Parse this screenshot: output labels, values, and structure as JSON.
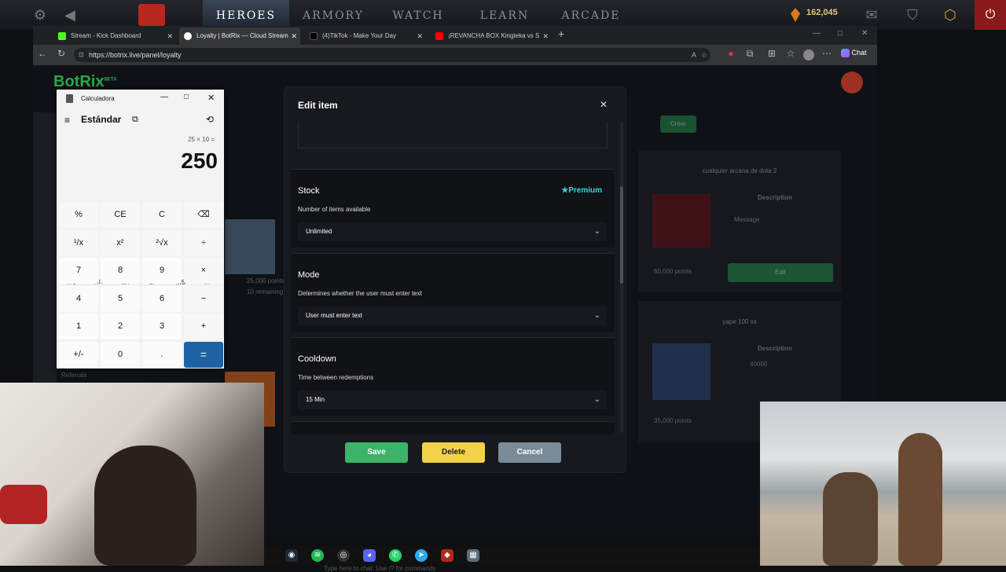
{
  "dota": {
    "tabs": [
      {
        "label": "HEROES",
        "active": true
      },
      {
        "label": "ARMORY",
        "active": false
      },
      {
        "label": "WATCH",
        "active": false
      },
      {
        "label": "LEARN",
        "active": false
      },
      {
        "label": "ARCADE",
        "active": false
      }
    ],
    "shards": "162,045"
  },
  "browser": {
    "tabs": [
      {
        "title": "Stream - Kick Dashboard",
        "color": "#53fc18"
      },
      {
        "title": "Loyalty | BotRix — Cloud Streaming",
        "color": "#ffffff"
      },
      {
        "title": "(4)TikTok - Make Your Day",
        "color": "#000000"
      },
      {
        "title": "¡REVANCHA BOX Kingteka vs S",
        "color": "#ff0000"
      }
    ],
    "url": "https://botrix.live/panel/loyalty",
    "chat_label": "Chat"
  },
  "background_page": {
    "logo": "BotRix",
    "logo_sup": "BETA",
    "create_label": "Crear",
    "sidebar_label": "Referrals",
    "card1": {
      "title": "cualquier arcana de dota 2",
      "desc_header": "Description",
      "desc": "Message",
      "points": "60,000 points",
      "button": "Edit"
    },
    "card2": {
      "title": "yape 100 ss",
      "desc_header": "Description",
      "desc": "40000",
      "points": "35,000 points"
    },
    "left_item": {
      "points": "25,000 points",
      "remaining": "10 remaining"
    },
    "chat_placeholder": "Type here to chat. Use /? for commands"
  },
  "calculator": {
    "title": "Calculadora",
    "mode": "Estándar",
    "expression": "25 × 10 =",
    "display": "250",
    "memory": [
      "MC",
      "MR",
      "M+",
      "M−",
      "MS",
      "M˅"
    ],
    "keys": [
      [
        "%",
        "CE",
        "C",
        "⌫"
      ],
      [
        "¹/x",
        "x²",
        "²√x",
        "÷"
      ],
      [
        "7",
        "8",
        "9",
        "×"
      ],
      [
        "4",
        "5",
        "6",
        "−"
      ],
      [
        "1",
        "2",
        "3",
        "+"
      ],
      [
        "+/-",
        "0",
        ".",
        "="
      ]
    ]
  },
  "modal": {
    "title": "Edit item",
    "stock": {
      "title": "Stock",
      "premium": "Premium",
      "desc": "Number of items available",
      "value": "Unlimited"
    },
    "mode": {
      "title": "Mode",
      "desc": "Determines whether the user must enter text",
      "value": "User must enter text"
    },
    "cooldown": {
      "title": "Cooldown",
      "desc": "Time between redemptions",
      "value": "15 Min"
    },
    "buttons": {
      "save": "Save",
      "delete": "Delete",
      "cancel": "Cancel"
    },
    "colors": {
      "save": "#3bb36a",
      "delete": "#f2d24b",
      "cancel": "#7a8a96",
      "premium": "#3ed3d6"
    }
  }
}
